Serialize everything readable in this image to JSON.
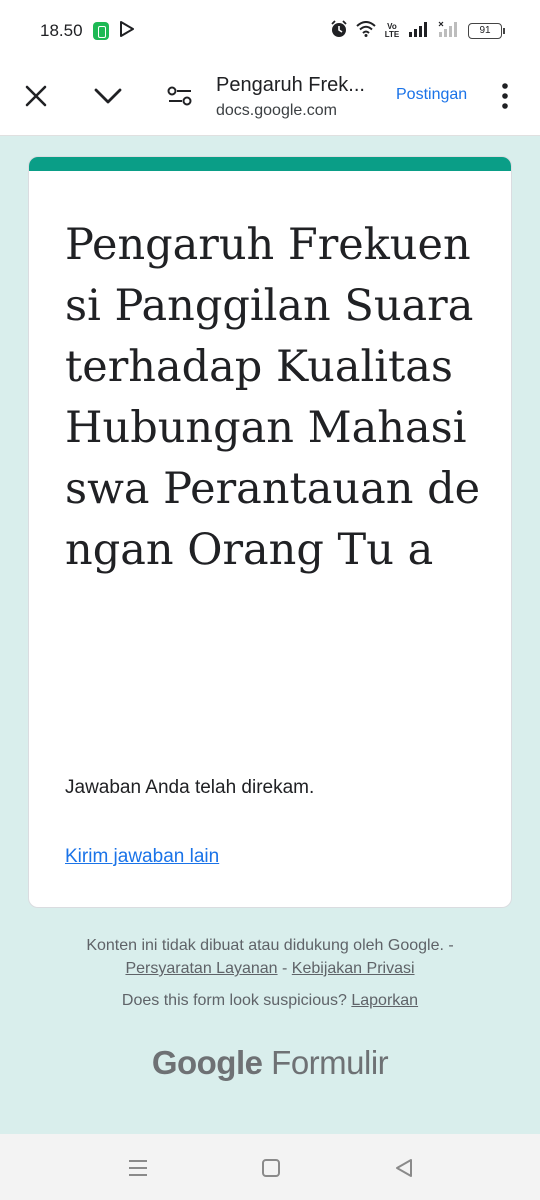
{
  "status_bar": {
    "time": "18.50",
    "battery": "91",
    "network_label": "Vo LTE"
  },
  "toolbar": {
    "title": "Pengaruh Frek...",
    "url": "docs.google.com",
    "post_label": "Postingan"
  },
  "form": {
    "title": "Pengaruh Frekuensi Panggilan Suara terhadap Kualitas Hubungan Mahasiswa Perantauan dengan Orang Tu a",
    "confirmation": "Jawaban Anda telah direkam.",
    "resubmit_link": "Kirim jawaban lain"
  },
  "footer": {
    "disclaimer": "Konten ini tidak dibuat atau didukung oleh Google. -",
    "terms_link": "Persyaratan Layanan",
    "separator": "-",
    "privacy_link": "Kebijakan Privasi",
    "report_question": "Does this form look suspicious?",
    "report_link": "Laporkan",
    "logo_google": "Google",
    "logo_forms": "Formulir"
  },
  "colors": {
    "accent": "#0a9e87",
    "background": "#d9eeec",
    "link": "#1a73e8"
  }
}
